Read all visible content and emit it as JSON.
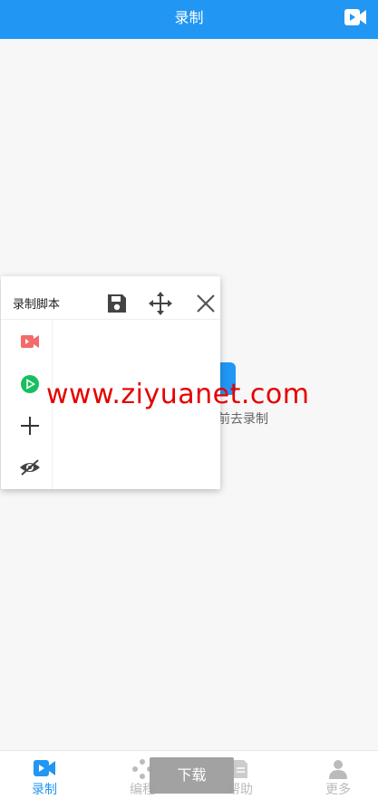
{
  "header": {
    "title": "录制",
    "action_icon": "video-camera-icon"
  },
  "background": {
    "hint_text": "前去录制"
  },
  "panel": {
    "title": "录制脚本",
    "header_icons": [
      "save-icon",
      "move-icon",
      "close-icon"
    ],
    "tools": [
      "record-video-icon",
      "play-icon",
      "add-icon",
      "eye-hidden-icon"
    ]
  },
  "watermark": "www.ziyuanet.com",
  "bottom_tabs": [
    {
      "label": "录制",
      "active": true
    },
    {
      "label": "编程",
      "active": false
    },
    {
      "label": "帮助",
      "active": false
    },
    {
      "label": "更多",
      "active": false
    }
  ],
  "download_label": "下载",
  "colors": {
    "accent": "#2196f3",
    "record_red": "#f46a6a",
    "play_green": "#16c060"
  }
}
